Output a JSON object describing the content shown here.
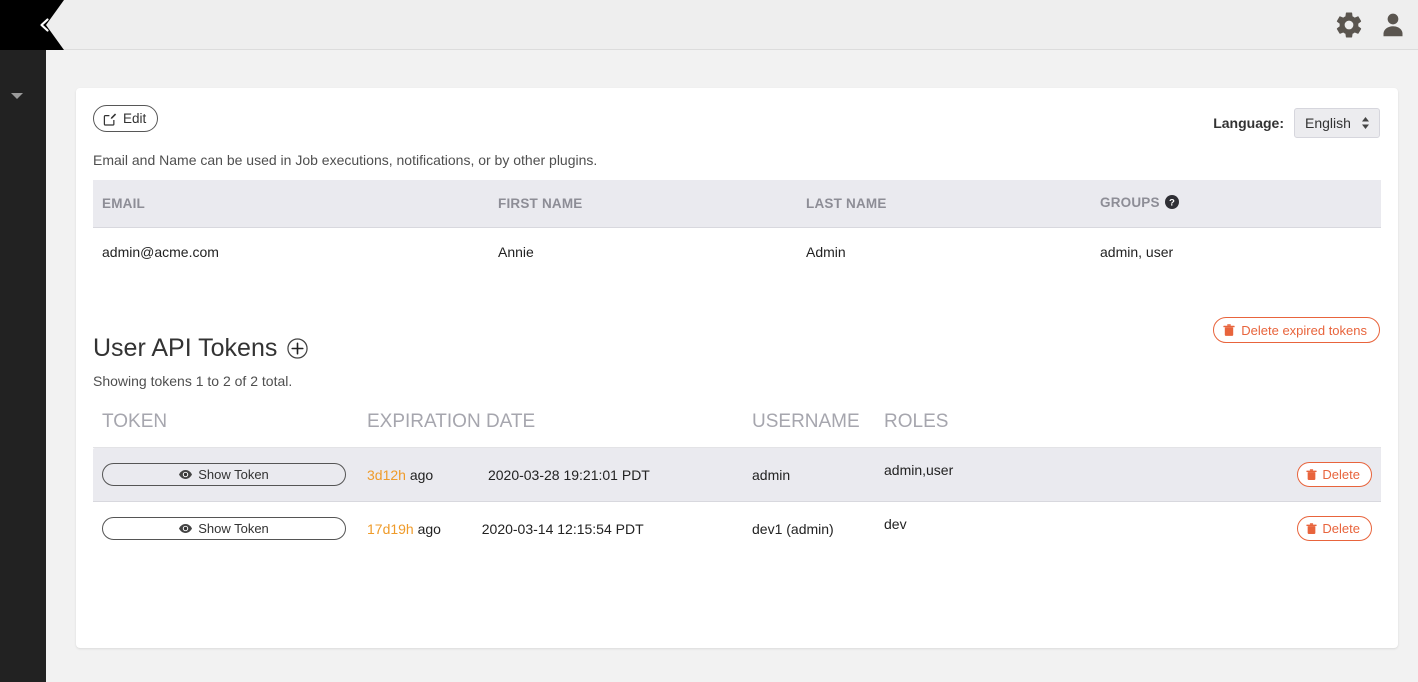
{
  "sidebar": {
    "collapse_icon": "chevron-left-icon",
    "caret_icon": "caret-down-icon"
  },
  "topbar": {
    "settings_icon": "gear-icon",
    "user_icon": "user-avatar-icon"
  },
  "profile": {
    "edit_label": "Edit",
    "edit_icon": "edit-square-icon",
    "language_label": "Language:",
    "language_value": "English",
    "language_options": [
      "English"
    ],
    "hint": "Email and Name can be used in Job executions, notifications, or by other plugins.",
    "columns": [
      "EMAIL",
      "FIRST NAME",
      "LAST NAME",
      "GROUPS"
    ],
    "groups_help_icon": "question-circle-icon",
    "row": {
      "email": "admin@acme.com",
      "first_name": "Annie",
      "last_name": "Admin",
      "groups": "admin, user"
    }
  },
  "tokens": {
    "title": "User API Tokens",
    "add_icon": "plus-circle-icon",
    "delete_expired_label": "Delete expired tokens",
    "delete_expired_icon": "trash-icon",
    "count_text": "Showing tokens 1 to 2 of 2 total.",
    "columns": [
      "TOKEN",
      "EXPIRATION DATE",
      "USERNAME",
      "ROLES"
    ],
    "show_token_label": "Show Token",
    "show_token_icon": "eye-icon",
    "delete_label": "Delete",
    "delete_icon": "trash-icon",
    "rows": [
      {
        "expiry_relative": "3d12h",
        "expiry_ago": "ago",
        "expiry_date": "2020-03-28 19:21:01 PDT",
        "username": "admin",
        "roles": "admin,user"
      },
      {
        "expiry_relative": "17d19h",
        "expiry_ago": "ago",
        "expiry_date": "2020-03-14 12:15:54 PDT",
        "username": "dev1 (admin)",
        "roles": "dev"
      }
    ]
  },
  "colors": {
    "accent_orange": "#e8643c",
    "expiry_amber": "#ef9b2a",
    "sidebar_dark": "#222222",
    "header_grey": "#eeeeee"
  }
}
